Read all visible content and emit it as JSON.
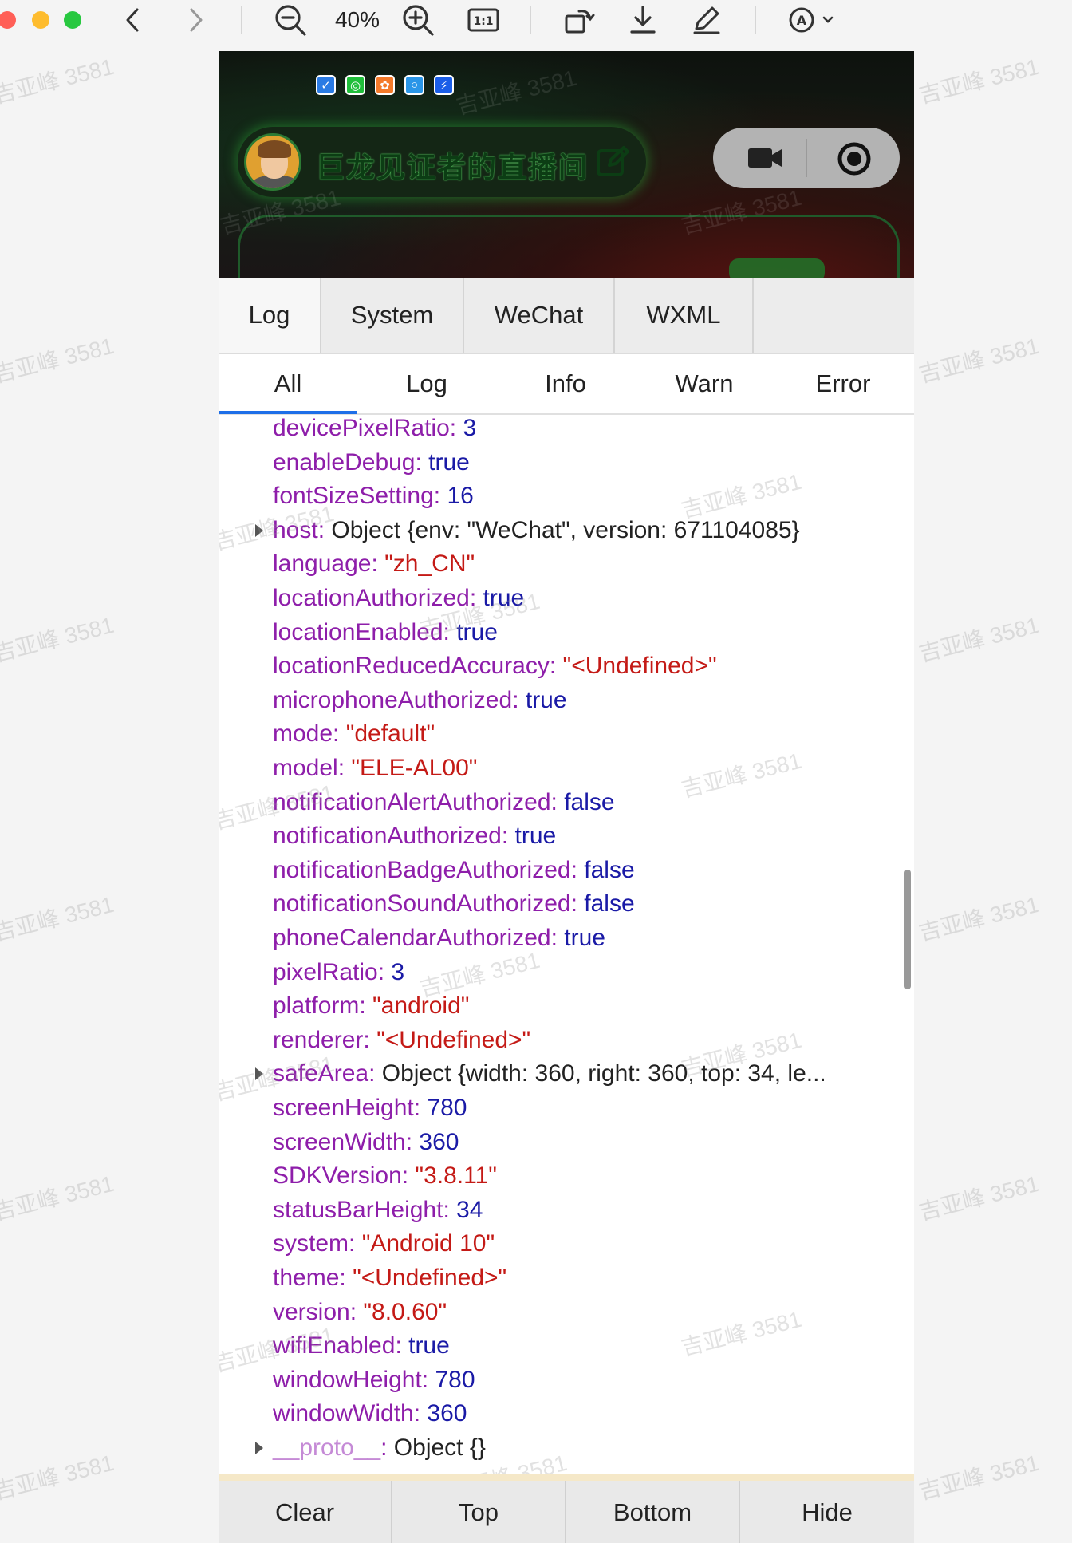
{
  "viewer": {
    "zoom_label": "40%",
    "icons": [
      "close-dot",
      "minimize-dot",
      "maximize-dot",
      "back-icon",
      "forward-icon",
      "zoom-out-icon",
      "zoom-in-icon",
      "actual-size-icon",
      "rotate-icon",
      "download-icon",
      "markup-icon",
      "annotate-icon"
    ],
    "actual_size_label": "1:1"
  },
  "banner": {
    "host_name": "巨龙见证者的直播间",
    "app_icons": [
      "mail-app-icon",
      "wechat-app-icon",
      "orange-app-icon",
      "search-app-icon",
      "blue-app-icon"
    ]
  },
  "tabs": [
    "Log",
    "System",
    "WeChat",
    "WXML"
  ],
  "filters": [
    "All",
    "Log",
    "Info",
    "Warn",
    "Error"
  ],
  "log_entries": [
    {
      "key": "devicePixelRatio",
      "value": "3",
      "type": "number"
    },
    {
      "key": "enableDebug",
      "value": "true",
      "type": "number"
    },
    {
      "key": "fontSizeSetting",
      "value": "16",
      "type": "number"
    },
    {
      "key": "host",
      "value": "Object {env: \"WeChat\", version: 671104085}",
      "type": "object",
      "expandable": true
    },
    {
      "key": "language",
      "value": "\"zh_CN\"",
      "type": "string"
    },
    {
      "key": "locationAuthorized",
      "value": "true",
      "type": "number"
    },
    {
      "key": "locationEnabled",
      "value": "true",
      "type": "number"
    },
    {
      "key": "locationReducedAccuracy",
      "value": "\"<Undefined>\"",
      "type": "string"
    },
    {
      "key": "microphoneAuthorized",
      "value": "true",
      "type": "number"
    },
    {
      "key": "mode",
      "value": "\"default\"",
      "type": "string"
    },
    {
      "key": "model",
      "value": "\"ELE-AL00\"",
      "type": "string"
    },
    {
      "key": "notificationAlertAuthorized",
      "value": "false",
      "type": "number"
    },
    {
      "key": "notificationAuthorized",
      "value": "true",
      "type": "number"
    },
    {
      "key": "notificationBadgeAuthorized",
      "value": "false",
      "type": "number"
    },
    {
      "key": "notificationSoundAuthorized",
      "value": "false",
      "type": "number"
    },
    {
      "key": "phoneCalendarAuthorized",
      "value": "true",
      "type": "number"
    },
    {
      "key": "pixelRatio",
      "value": "3",
      "type": "number"
    },
    {
      "key": "platform",
      "value": "\"android\"",
      "type": "string"
    },
    {
      "key": "renderer",
      "value": "\"<Undefined>\"",
      "type": "string"
    },
    {
      "key": "safeArea",
      "value": "Object {width: 360, right: 360, top: 34, le...",
      "type": "object",
      "expandable": true
    },
    {
      "key": "screenHeight",
      "value": "780",
      "type": "number"
    },
    {
      "key": "screenWidth",
      "value": "360",
      "type": "number"
    },
    {
      "key": "SDKVersion",
      "value": "\"3.8.11\"",
      "type": "string",
      "highlighted": true
    },
    {
      "key": "statusBarHeight",
      "value": "34",
      "type": "number"
    },
    {
      "key": "system",
      "value": "\"Android 10\"",
      "type": "string"
    },
    {
      "key": "theme",
      "value": "\"<Undefined>\"",
      "type": "string"
    },
    {
      "key": "version",
      "value": "\"8.0.60\"",
      "type": "string"
    },
    {
      "key": "wifiEnabled",
      "value": "true",
      "type": "number"
    },
    {
      "key": "windowHeight",
      "value": "780",
      "type": "number"
    },
    {
      "key": "windowWidth",
      "value": "360",
      "type": "number"
    },
    {
      "key": "__proto__",
      "value": "Object {}",
      "type": "object",
      "expandable": true,
      "dim_key": true
    }
  ],
  "actions": [
    "Clear",
    "Top",
    "Bottom",
    "Hide"
  ],
  "watermark_text": "吉亚峰 3581",
  "colors": {
    "key": "#8e1eaa",
    "number_value": "#1a1aa6",
    "string_value": "#c41a16",
    "highlight_box": "#e2363a",
    "active_filter": "#1e6fe8"
  }
}
